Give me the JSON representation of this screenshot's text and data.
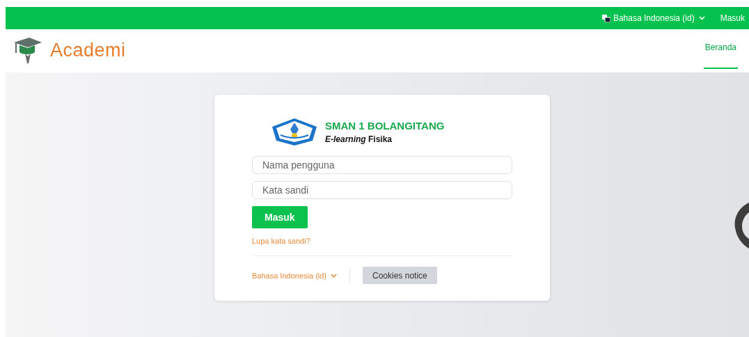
{
  "top_bar": {
    "language": "Bahasa Indonesia (id)",
    "login_link": "Masuk"
  },
  "header": {
    "logo": "Academi",
    "nav": [
      {
        "label": "Beranda",
        "selected": true
      }
    ]
  },
  "login": {
    "school": "SMAN 1 BOLANGITANG",
    "subtitle": "*E-learning* Fisika",
    "username": {
      "placeholder": "Nama pengguna"
    },
    "password": {
      "placeholder": "Kata sandi"
    },
    "submit": "Masuk",
    "forgot": "Lupa kata sandi?",
    "language": "Bahasa Indonesia (id)",
    "cookies": "Cookies notice"
  }
}
